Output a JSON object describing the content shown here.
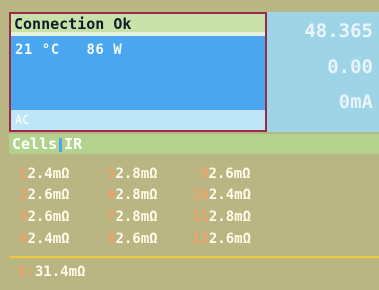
{
  "status": {
    "connection": "Connection Ok",
    "temperature": "21 °C",
    "power": "86 W",
    "mode": "AC"
  },
  "values": {
    "v1": "48.365",
    "v2": "0.00",
    "v3": "0mA"
  },
  "cells": {
    "tab_cells": "Cells",
    "tab_ir": "IR",
    "items": [
      {
        "n": "1",
        "v": "2.4mΩ"
      },
      {
        "n": "2",
        "v": "2.6mΩ"
      },
      {
        "n": "3",
        "v": "2.6mΩ"
      },
      {
        "n": "4",
        "v": "2.4mΩ"
      },
      {
        "n": "5",
        "v": "2.8mΩ"
      },
      {
        "n": "6",
        "v": "2.8mΩ"
      },
      {
        "n": "7",
        "v": "2.8mΩ"
      },
      {
        "n": "8",
        "v": "2.6mΩ"
      },
      {
        "n": "9",
        "v": "2.6mΩ"
      },
      {
        "n": "10",
        "v": "2.4mΩ"
      },
      {
        "n": "11",
        "v": "2.8mΩ"
      },
      {
        "n": "12",
        "v": "2.6mΩ"
      }
    ],
    "sum_label": "S:",
    "sum_value": "31.4mΩ"
  }
}
